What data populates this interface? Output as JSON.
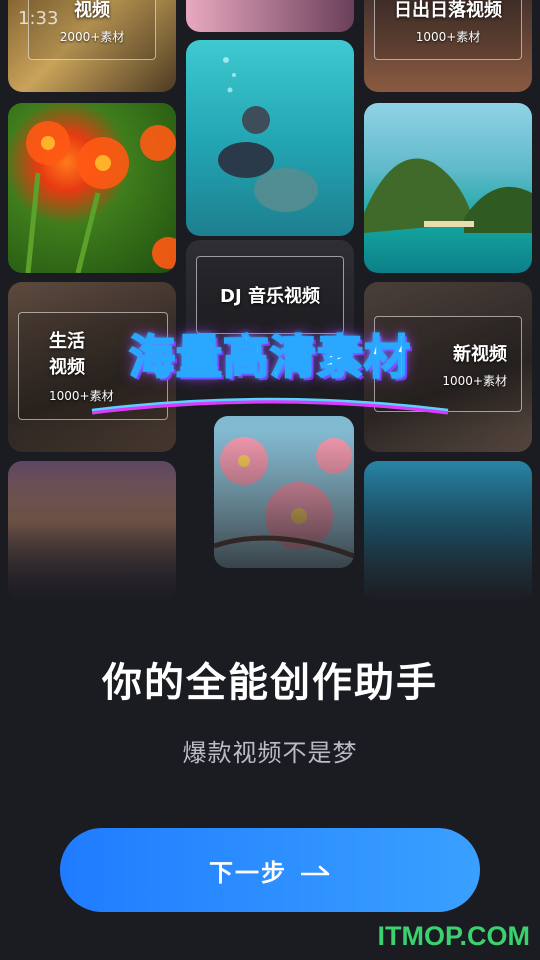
{
  "status_bar": {
    "time": "1:33"
  },
  "collage": {
    "tiles": [
      {
        "category": "视频",
        "count": "2000+素材"
      },
      {
        "category": "日出日落视频",
        "count": "1000+素材"
      },
      {
        "category": "DJ 音乐视频",
        "count": ""
      },
      {
        "category": "生活视频",
        "count": "1000+素材"
      },
      {
        "category": "新视频",
        "count": "1000+素材"
      }
    ],
    "banner": "海量高清素材"
  },
  "headline": "你的全能创作助手",
  "subline": "爆款视频不是梦",
  "next_button": {
    "label": "下一步",
    "icon": "arrow-right-icon"
  },
  "watermark": "ITMOP.COM",
  "colors": {
    "background": "#1b1c21",
    "button_start": "#1f7cff",
    "button_end": "#3aa0ff",
    "watermark": "#3ad16e"
  }
}
